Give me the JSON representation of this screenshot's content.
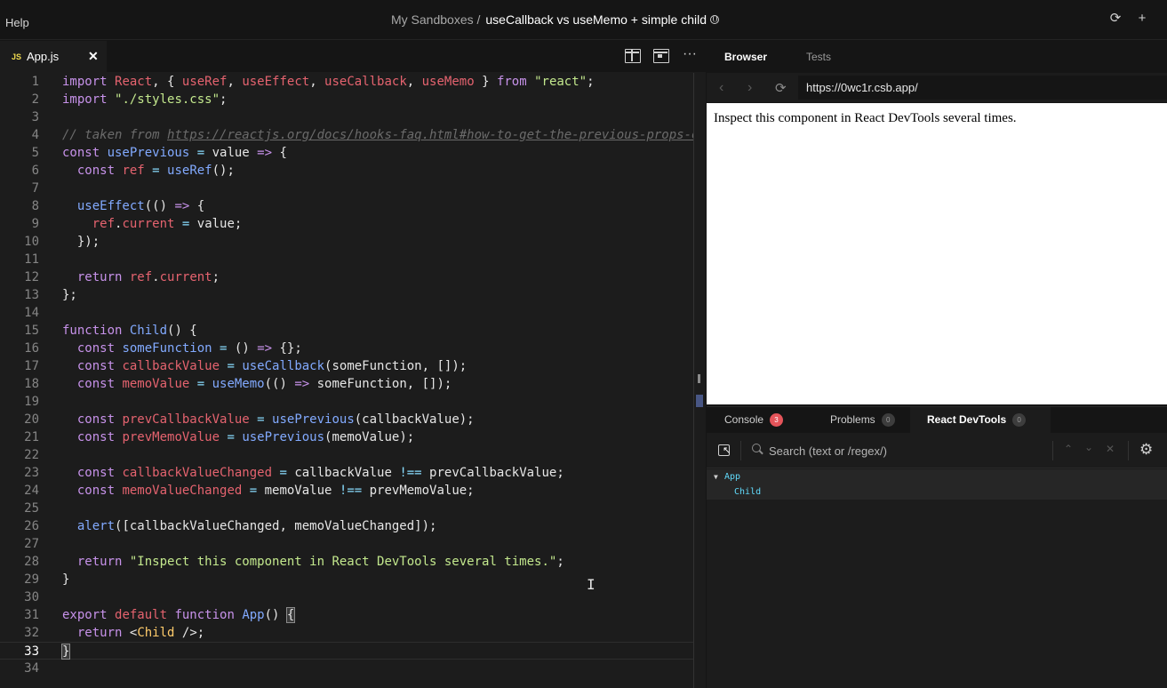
{
  "topbar": {
    "help": "Help",
    "crumb": "My Sandboxes /",
    "title": "useCallback vs useMemo + simple child",
    "icons": [
      "globe-icon",
      "refresh-icon",
      "plus-icon"
    ]
  },
  "editor": {
    "tab": {
      "badge": "JS",
      "filename": "App.js",
      "close": "✕"
    },
    "toolbar_icons": [
      "split-view-icon",
      "preview-icon",
      "more-icon"
    ],
    "more": "···",
    "current_line": 33
  },
  "preview": {
    "tabs": [
      "Browser",
      "Tests"
    ],
    "url": "https://0wc1r.csb.app/",
    "page_text": "Inspect this component in React DevTools several times."
  },
  "devtools": {
    "tabs": [
      {
        "label": "Console",
        "badge": "3"
      },
      {
        "label": "Problems",
        "badge": "0"
      },
      {
        "label": "React DevTools",
        "badge": "0"
      }
    ],
    "search_placeholder": "Search (text or /regex/)",
    "tree": [
      "App",
      "Child"
    ]
  },
  "colors": {
    "keyword": "#c792ea",
    "variable": "#e5636f",
    "function": "#82aaff",
    "string": "#c3e88d",
    "comment": "#6b6b6b",
    "react_component": "#61dafb",
    "console_badge": "#e5545a"
  }
}
